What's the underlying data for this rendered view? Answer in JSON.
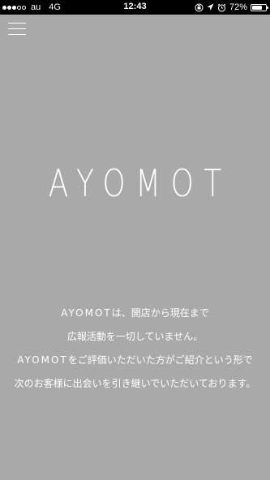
{
  "status_bar": {
    "carrier": "au",
    "network": "4G",
    "time": "12:43",
    "battery": "72%",
    "battery_level": 0.72,
    "signal_bars": 3,
    "signal_total": 5
  },
  "header": {
    "menu_icon": "hamburger-menu-icon"
  },
  "hero": {
    "logo": "AYOMOT"
  },
  "message": {
    "line1_brand": "AYOMOT",
    "line1_rest": "は、開店から現在まで",
    "line2": "広報活動を一切していません。",
    "line3_brand": "AYOMOT",
    "line3_rest": "をご評価いただいた方がご紹介という形で",
    "line4": "次のお客様に出会いを引き継いでいただいております。"
  },
  "colors": {
    "background": "#a9a9a9",
    "status_bar": "#000000",
    "text": "#ffffff"
  }
}
